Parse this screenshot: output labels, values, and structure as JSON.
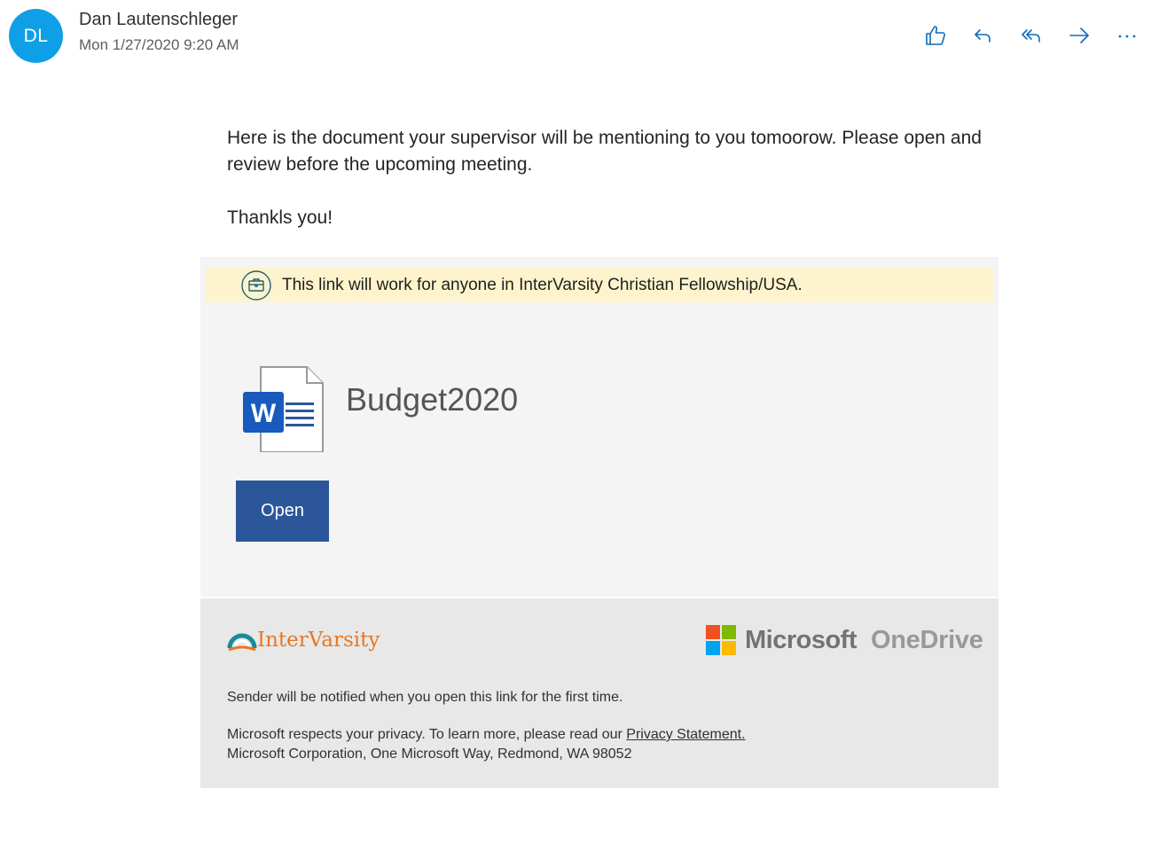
{
  "header": {
    "avatar_initials": "DL",
    "avatar_color": "#0f9fe6",
    "sender_name": "Dan Lautenschleger",
    "sent_date": "Mon 1/27/2020 9:20 AM",
    "actions": [
      {
        "name": "like",
        "icon": "thumbs-up-icon"
      },
      {
        "name": "reply",
        "icon": "reply-icon"
      },
      {
        "name": "reply-all",
        "icon": "reply-all-icon"
      },
      {
        "name": "forward",
        "icon": "forward-icon"
      },
      {
        "name": "more",
        "icon": "more-icon"
      }
    ]
  },
  "message": {
    "paragraph1": "Here is the document your supervisor will be mentioning to you tomoorow. Please open and review before the upcoming meeting.",
    "paragraph2": "Thankls you!"
  },
  "share_card": {
    "notice_text": "This link will work for anyone in InterVarsity Christian Fellowship/USA.",
    "notice_icon": "briefcase-icon",
    "notice_bg": "#fdf4cd",
    "document_icon": "word-document-icon",
    "document_name": "Budget2020",
    "open_label": "Open",
    "open_color": "#2b579a"
  },
  "footer": {
    "org_logo_text": "InterVarsity",
    "org_logo_color": "#e87722",
    "ms_text": "Microsoft",
    "onedrive_text": "OneDrive",
    "notify_text": "Sender will be notified when you open this link for the first time.",
    "privacy_prefix": "Microsoft respects your privacy. To learn more, please read our ",
    "privacy_link": "Privacy Statement.",
    "address": "Microsoft Corporation, One Microsoft Way, Redmond, WA 98052"
  }
}
